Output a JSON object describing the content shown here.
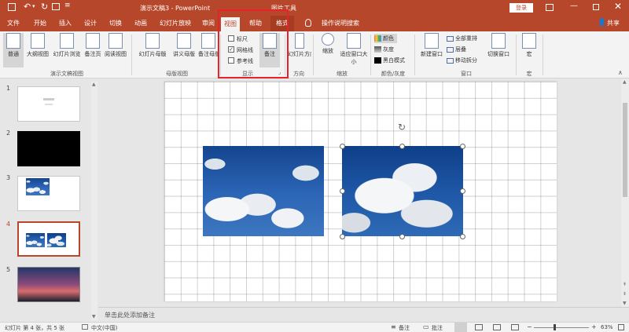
{
  "titlebar": {
    "title": "演示文稿3  -  PowerPoint",
    "context_tools": "图片工具",
    "login_label": "登录"
  },
  "tabs": {
    "items": [
      "文件",
      "开始",
      "插入",
      "设计",
      "切换",
      "动画",
      "幻灯片放映",
      "审阅",
      "视图",
      "帮助",
      "格式"
    ],
    "active": "视图",
    "tell_me": "操作说明搜索",
    "share": "共享"
  },
  "ribbon": {
    "presentation_views": {
      "label": "演示文稿视图",
      "buttons": [
        "普通",
        "大纲视图",
        "幻灯片浏览",
        "备注页",
        "阅读视图"
      ]
    },
    "master_views": {
      "label": "母版视图",
      "buttons": [
        "幻灯片母版",
        "讲义母版",
        "备注母版"
      ]
    },
    "show": {
      "label": "显示",
      "checkboxes": [
        {
          "label": "标尺",
          "checked": false
        },
        {
          "label": "网格线",
          "checked": true
        },
        {
          "label": "参考线",
          "checked": false
        }
      ],
      "notes_button": "备注"
    },
    "direction": {
      "label": "方向",
      "button": "幻灯片方向"
    },
    "zoom": {
      "label": "缩放",
      "buttons": [
        "缩放",
        "适应窗口大小"
      ]
    },
    "color": {
      "label": "颜色/灰度",
      "options": [
        "颜色",
        "灰度",
        "黑白模式"
      ]
    },
    "window": {
      "label": "窗口",
      "new_window": "新建窗口",
      "options": [
        "全部重排",
        "层叠",
        "移动拆分"
      ],
      "switch_window": "切换窗口"
    },
    "macros": {
      "label": "宏",
      "button": "宏"
    }
  },
  "thumbnails": {
    "numbers": [
      "1",
      "2",
      "3",
      "4",
      "5"
    ],
    "active": "4"
  },
  "notes": {
    "placeholder": "单击此处添加备注"
  },
  "statusbar": {
    "slide_info": "幻灯片 第 4 张，共 5 张",
    "language": "中文(中国)",
    "notes": "备注",
    "comments": "批注",
    "zoom_percent": "63%"
  },
  "colors": {
    "accent": "#b7472a",
    "highlight": "#e8222a"
  }
}
